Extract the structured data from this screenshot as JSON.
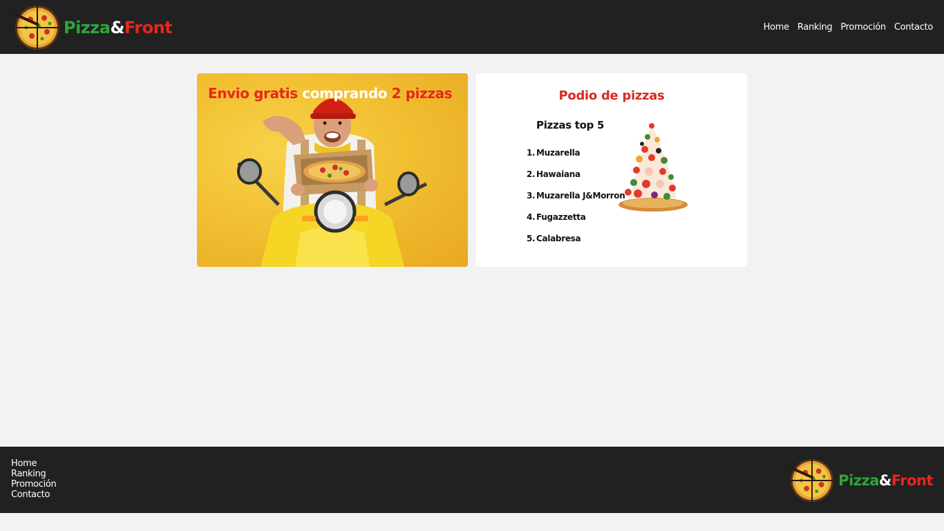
{
  "header": {
    "brand": {
      "part1": "Pizza",
      "part2": "&",
      "part3": "Front"
    },
    "nav": [
      "Home",
      "Ranking",
      "Promoción",
      "Contacto"
    ]
  },
  "promo": {
    "title_part1": "Envio gratis",
    "title_part2": "comprando",
    "title_part3": "2 pizzas"
  },
  "podium": {
    "title": "Podio de pizzas",
    "subtitle": "Pizzas top 5",
    "items": [
      {
        "rank": "1.",
        "name": "Muzarella"
      },
      {
        "rank": "2.",
        "name": "Hawaiana"
      },
      {
        "rank": "3.",
        "name": "Muzarella J&Morron"
      },
      {
        "rank": "4.",
        "name": "Fugazzetta"
      },
      {
        "rank": "5.",
        "name": "Calabresa"
      }
    ]
  },
  "footer": {
    "nav": [
      "Home",
      "Ranking",
      "Promoción",
      "Contacto"
    ],
    "brand": {
      "part1": "Pizza",
      "part2": "&",
      "part3": "Front"
    }
  },
  "colors": {
    "dark": "#212121",
    "accent_red": "#e8261b",
    "accent_green": "#2fa53a",
    "promo_bg": "#f2c032"
  },
  "icons": {
    "logo": "pizza-icon",
    "promo_image": "delivery-rider-image",
    "podium_image": "pizza-tower-image"
  }
}
